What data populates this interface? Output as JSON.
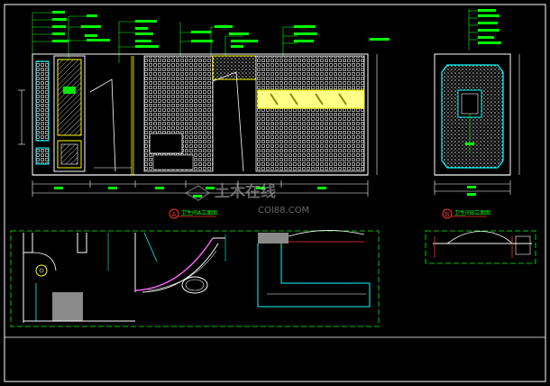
{
  "drawing": {
    "colors": {
      "background": "#000000",
      "line_white": "#ffffff",
      "line_yellow": "#ffff00",
      "line_green": "#00ff00",
      "line_cyan": "#00ffff",
      "line_blue": "#3b5bff",
      "line_red": "#ff3333",
      "line_magenta": "#ff66ff",
      "fill_grey": "#8a8a8a"
    },
    "watermark": {
      "title": "土木在线",
      "site": "COI88.COM"
    },
    "elevation_a": {
      "marker": "A",
      "caption": "卫生间A立面图"
    },
    "elevation_b": {
      "marker": "B",
      "caption": "卫生间B立面图"
    }
  }
}
